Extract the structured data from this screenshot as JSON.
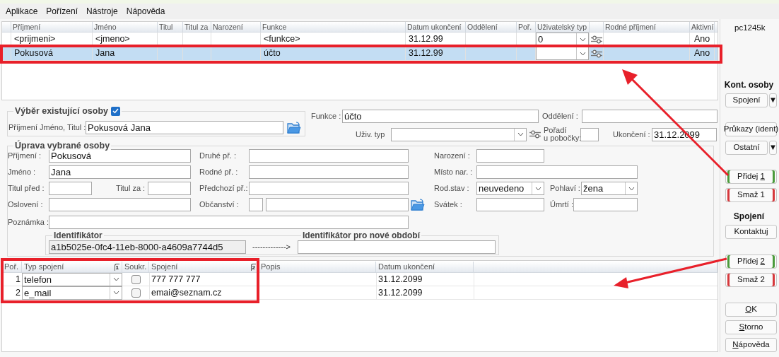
{
  "menu": [
    "Aplikace",
    "Pořízení",
    "Nástroje",
    "Nápověda"
  ],
  "people_grid": {
    "columns": [
      {
        "label": "Příjmení",
        "kind": "text"
      },
      {
        "label": "Jméno",
        "kind": "text"
      },
      {
        "label": "Titul",
        "kind": "text"
      },
      {
        "label": "Titul za",
        "kind": "text"
      },
      {
        "label": "Narození",
        "kind": "text"
      },
      {
        "label": "Funkce",
        "kind": "text"
      },
      {
        "label": "Datum ukončení",
        "kind": "text"
      },
      {
        "label": "Oddělení",
        "kind": "text"
      },
      {
        "label": "Poř.",
        "kind": "text"
      },
      {
        "label": "Uživatelský typ",
        "kind": "combo"
      },
      {
        "kind": "icon"
      },
      {
        "label": "Rodné příjmení",
        "kind": "text"
      },
      {
        "label": "Aktivní",
        "kind": "flag"
      }
    ],
    "rows": [
      {
        "selected": false,
        "cells": [
          "<prijmeni>",
          "<jmeno>",
          null,
          null,
          null,
          "<funkce>",
          "31.12.99",
          null,
          null,
          "0",
          null,
          null,
          "Ano"
        ]
      },
      {
        "selected": true,
        "cells": [
          "Pokusová",
          "Jana",
          null,
          null,
          null,
          "účto",
          "31.12.99",
          null,
          null,
          null,
          null,
          null,
          "Ano"
        ]
      }
    ]
  },
  "selection": {
    "title": "Výběr existující osoby",
    "checked": true,
    "label": "Příjmení Jméno, Titul :",
    "value": "Pokusová Jana"
  },
  "header_fields": {
    "function": {
      "label": "Funkce :",
      "value": "účto"
    },
    "department": {
      "label": "Oddělení :"
    },
    "user_type": {
      "label": "Uživ. typ"
    },
    "branch_order": {
      "label_lines": [
        "Pořadí",
        "u pobočky:"
      ]
    },
    "end_date": {
      "label": "Ukončení :",
      "value": "31.12.2099"
    }
  },
  "edit": {
    "title": "Úprava vybrané osoby",
    "surname": {
      "label": "Příjmení :",
      "value": "Pokusová"
    },
    "first_name": {
      "label": "Jméno :",
      "value": "Jana"
    },
    "title_before": {
      "label": "Titul před :"
    },
    "title_after": {
      "label": "Titul za :"
    },
    "salutation": {
      "label": "Oslovení :"
    },
    "note": {
      "label": "Poznámka :"
    },
    "second_surname": {
      "label": "Druhé př. :"
    },
    "birth_surname": {
      "label": "Rodné př. :"
    },
    "previous_surname": {
      "label": "Předchozí př.:"
    },
    "citizenship": {
      "label": "Občanství :"
    },
    "birth_date": {
      "label": "Narození :"
    },
    "birth_place": {
      "label": "Místo nar. :"
    },
    "marital_status": {
      "label": "Rod.stav :",
      "value": "neuvedeno"
    },
    "sex": {
      "label": "Pohlaví :",
      "value": "žena"
    },
    "name_day": {
      "label": "Svátek :"
    },
    "death": {
      "label": "Úmrtí :"
    },
    "identifier": {
      "label": "Identifikátor",
      "value": "a1b5025e-0fc4-11eb-8000-a4609a7744d5",
      "arrow": "------------->",
      "new_label": "Identifikátor pro nové období"
    }
  },
  "contacts_grid": {
    "columns": [
      {
        "label": "Poř."
      },
      {
        "label": "Typ spojení",
        "sort": "1"
      },
      {
        "label": "Soukr."
      },
      {
        "label": "Spojení",
        "sort": "2"
      },
      {
        "label": "Popis"
      },
      {
        "label": "Datum ukončení"
      }
    ],
    "rows": [
      {
        "order": "1",
        "type": "telefon",
        "private": false,
        "contact": "777 777 777",
        "end": "31.12.2099"
      },
      {
        "order": "2",
        "type": "e_mail",
        "private": false,
        "contact": "emai@seznam.cz",
        "end": "31.12.2099"
      }
    ]
  },
  "sidebar": {
    "machine": "pc1245k",
    "items": [
      {
        "kind": "heading",
        "label": "Kont. osoby"
      },
      {
        "kind": "split_button",
        "label": "Spojení",
        "menu_glyph": "▼"
      },
      {
        "kind": "button",
        "label": "Průkazy (ident)"
      },
      {
        "kind": "split_button",
        "label": "Ostatní",
        "menu_glyph": "▼"
      },
      {
        "kind": "button",
        "label_before": "Přidej ",
        "mnemonic": "1",
        "color": "#4b9a3b"
      },
      {
        "kind": "button",
        "label": "Smaž 1",
        "color": "#d6383c"
      },
      {
        "kind": "heading",
        "label": "Spojení"
      },
      {
        "kind": "button",
        "label": "Kontaktuj"
      },
      {
        "kind": "button",
        "label_before": "Přidej ",
        "mnemonic": "2",
        "color": "#4b9a3b"
      },
      {
        "kind": "button",
        "label": "Smaž 2",
        "color": "#d6383c"
      },
      {
        "kind": "button",
        "mnemonic": "O",
        "label_after": "K"
      },
      {
        "kind": "button",
        "mnemonic": "S",
        "label_after": "torno"
      },
      {
        "kind": "button",
        "mnemonic": "N",
        "label_after": "ápověda"
      }
    ]
  }
}
